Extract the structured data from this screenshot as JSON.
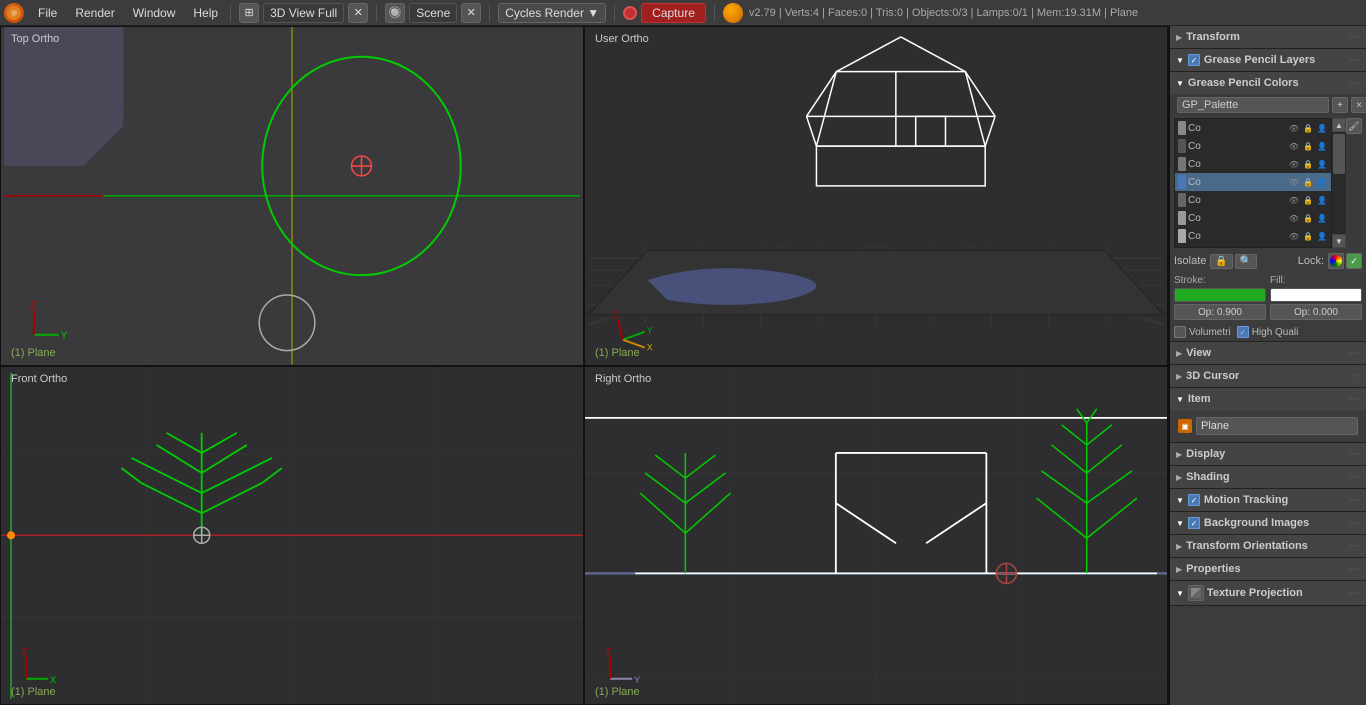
{
  "topbar": {
    "logo": "B",
    "menus": [
      "File",
      "Render",
      "Window",
      "Help"
    ],
    "view_label": "3D View Full",
    "scene_label": "Scene",
    "engine_label": "Cycles Render",
    "capture_label": "Capture",
    "status": "v2.79 | Verts:4 | Faces:0 | Tris:0 | Objects:0/3 | Lamps:0/1 | Mem:19.31M | Plane"
  },
  "viewports": {
    "top_left": {
      "label": "Top Ortho",
      "bottom_label": "(1) Plane"
    },
    "top_right": {
      "label": "User Ortho",
      "bottom_label": "(1) Plane"
    },
    "bottom_left": {
      "label": "Front Ortho",
      "bottom_label": "(1) Plane"
    },
    "bottom_right": {
      "label": "Right Ortho",
      "bottom_label": "(1) Plane"
    }
  },
  "right_panel": {
    "transform": {
      "title": "Transform",
      "collapsed": true
    },
    "grease_pencil_layers": {
      "title": "Grease Pencil Layers",
      "checked": true,
      "has_checkbox": true
    },
    "grease_pencil_colors": {
      "title": "Grease Pencil Colors",
      "palette_name": "GP_Palette",
      "add_btn": "+",
      "remove_btn": "×",
      "paint_btn": "🖌",
      "colors": [
        {
          "id": 1,
          "name": "Co",
          "swatch": "#888888",
          "selected": false
        },
        {
          "id": 2,
          "name": "Co",
          "swatch": "#555555",
          "selected": false
        },
        {
          "id": 3,
          "name": "Co",
          "swatch": "#777777",
          "selected": false
        },
        {
          "id": 4,
          "name": "Co",
          "swatch": "#4a7ab5",
          "selected": true
        },
        {
          "id": 5,
          "name": "Co",
          "swatch": "#666666",
          "selected": false
        },
        {
          "id": 6,
          "name": "Co",
          "swatch": "#999999",
          "selected": false
        },
        {
          "id": 7,
          "name": "Co",
          "swatch": "#aaaaaa",
          "selected": false
        }
      ],
      "isolate_label": "Isolate",
      "lock_label": "Lock:",
      "stroke_label": "Stroke:",
      "fill_label": "Fill:",
      "stroke_color": "#22aa22",
      "fill_color": "#ffffff",
      "stroke_opacity": "Op: 0.900",
      "fill_opacity": "Op: 0.000",
      "volumetric_label": "Volumetri",
      "high_quality_label": "High Quali",
      "volumetric_checked": false,
      "high_quality_checked": true
    },
    "view": {
      "title": "View",
      "collapsed": true
    },
    "cursor_3d": {
      "title": "3D Cursor",
      "collapsed": true
    },
    "item": {
      "title": "Item",
      "object_name": "Plane"
    },
    "display": {
      "title": "Display",
      "collapsed": true
    },
    "shading": {
      "title": "Shading",
      "collapsed": true
    },
    "motion_tracking": {
      "title": "Motion Tracking",
      "has_checkbox": true,
      "checked": true,
      "collapsed": false
    },
    "background_images": {
      "title": "Background Images",
      "has_checkbox": true,
      "checked": true,
      "collapsed": false
    },
    "transform_orientations": {
      "title": "Transform Orientations",
      "collapsed": true
    },
    "properties": {
      "title": "Properties",
      "collapsed": true
    },
    "texture_projection": {
      "title": "Texture Projection",
      "has_checkbox": true,
      "checked": false,
      "collapsed": false
    }
  }
}
